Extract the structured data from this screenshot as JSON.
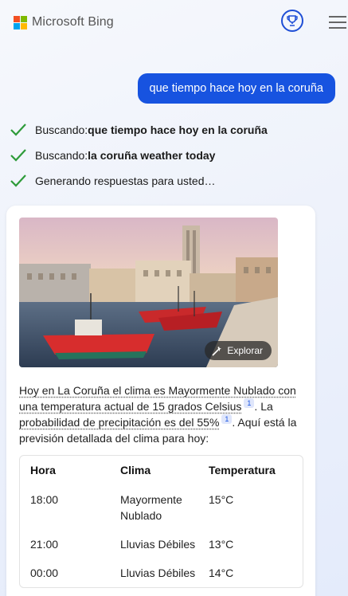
{
  "brand": {
    "name": "Microsoft Bing",
    "colors": {
      "red": "#f25022",
      "green": "#7fba00",
      "blue": "#00a4ef",
      "yellow": "#ffb900"
    }
  },
  "header": {
    "rewards_icon": "trophy-icon",
    "menu_icon": "hamburger-menu-icon"
  },
  "user_message": "que tiempo hace hoy en la coruña",
  "status": [
    {
      "prefix": "Buscando: ",
      "query": "que tiempo hace hoy en la coruña"
    },
    {
      "prefix": "Buscando: ",
      "query": "la coruña weather today"
    },
    {
      "prefix": "Generando respuestas para usted…",
      "query": ""
    }
  ],
  "answer": {
    "explore_label": "Explorar",
    "text_1": "Hoy en La Coruña el clima es Mayormente Nublado con una temperatura actual de 15 grados Celsius",
    "cite_1": "1",
    "text_2": ". La ",
    "text_3": "probabilidad de precipitación es del 55%",
    "cite_2": "1",
    "text_4": ". Aquí está la previsión detallada del clima para hoy:"
  },
  "table": {
    "headers": [
      "Hora",
      "Clima",
      "Temperatura"
    ],
    "rows": [
      {
        "hora": "18:00",
        "clima": "Mayormente Nublado",
        "temp": "15°C"
      },
      {
        "hora": "21:00",
        "clima": "Lluvias Débiles",
        "temp": "13°C"
      },
      {
        "hora": "00:00",
        "clima": "Lluvias Débiles",
        "temp": "14°C"
      }
    ]
  },
  "accent_color": "#1753e0",
  "check_color": "#2e9b3a"
}
